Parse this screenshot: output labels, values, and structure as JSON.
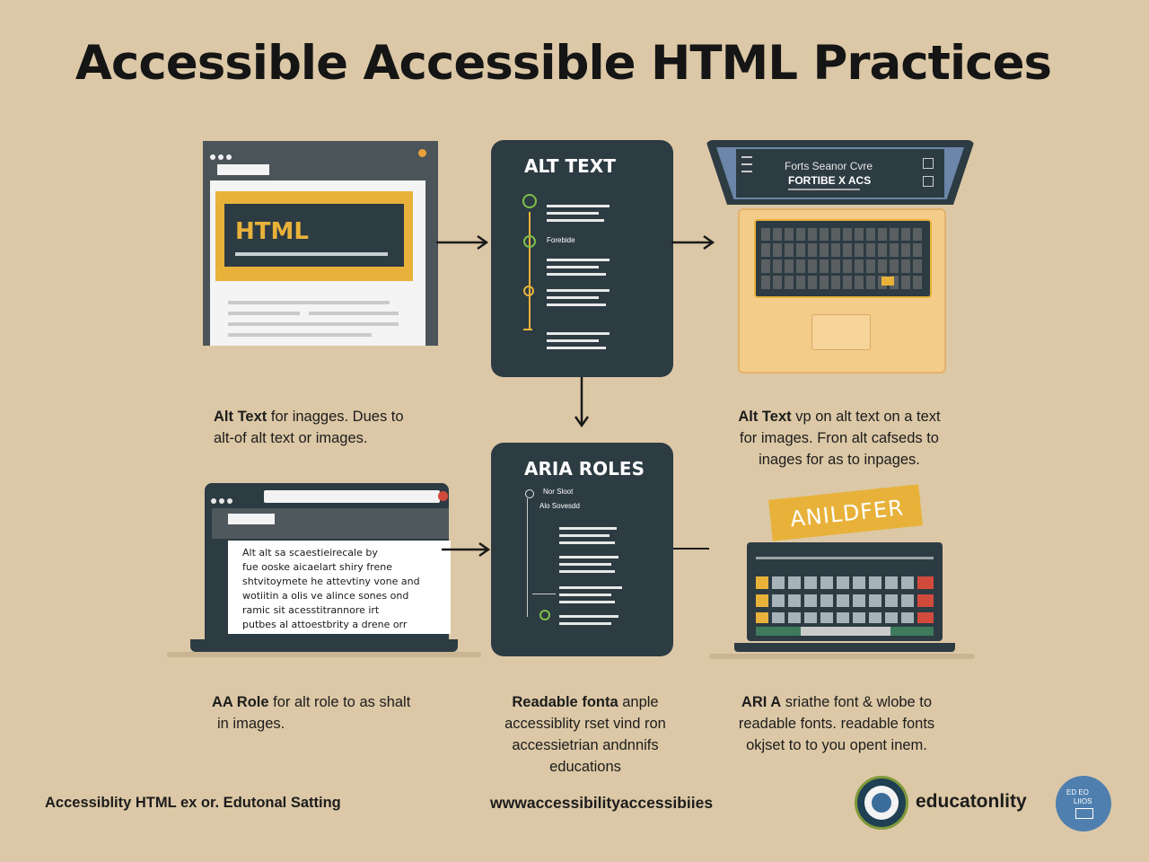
{
  "title": "Accessible Accessible HTML Practices",
  "panels": {
    "html_label": "HTML",
    "alt_text_title": "ALT TEXT",
    "alt_text_sub": "Forebide",
    "aria_title": "ARIA ROLES",
    "aria_sub1": "Nor Sloot",
    "aria_sub2": "Alo Sovesdd",
    "laptop_screen_line1": "Forts Seanor Cvre",
    "laptop_screen_line2": "FORTIBE X ACS",
    "laptop_text_lines": [
      "Alt alt sa scaestieirecale by",
      "fue ooske aicaelart shiry frene",
      "shtvitoymete he attevtiny vone and",
      "wotiitin a olis ve alince sones ond",
      "ramic sit acesstitrannore irt",
      "putbes al attoestbrity a drene orr"
    ],
    "badge": "ANILDFER"
  },
  "captions": {
    "c1": {
      "bold": "Alt Text",
      "rest": " for inagges. Dues to",
      "line2": "alt-of alt text or images."
    },
    "c2": {
      "bold": "Alt Text",
      "line1_rest": " vp on alt text on a text",
      "line2": "for images. Fron alt cafseds to",
      "line3": "inages for as to inpages."
    },
    "c3": {
      "bold": "AA Role",
      "rest": " for alt role to as shalt",
      "line2": "in images."
    },
    "c4": {
      "bold": "Readable fonta",
      "rest": " anple",
      "line2": "accessiblity rset vind ron",
      "line3": "accessietrian andnnifs",
      "line4": "educations"
    },
    "c5": {
      "bold": "ARI A",
      "rest": " sriathe font & wlobe to",
      "line2": "readable fonts. readable fonts",
      "line3": "okjset to to you opent inem."
    }
  },
  "footer": {
    "left": "Accessiblity HTML ex or.  Edutonal Satting",
    "center": "wwwaccessibilityaccessibiies",
    "right": "educatonlity",
    "seal_text1": "ED  EO",
    "seal_text2": "LIIOS"
  },
  "colors": {
    "background": "#dcc8a6",
    "dark_panel": "#2d3b43",
    "accent_yellow": "#e8b23a",
    "accent_green": "#7fbf4a",
    "laptop_tan": "#f4cc8a",
    "seal_blue": "#4f7fae"
  }
}
